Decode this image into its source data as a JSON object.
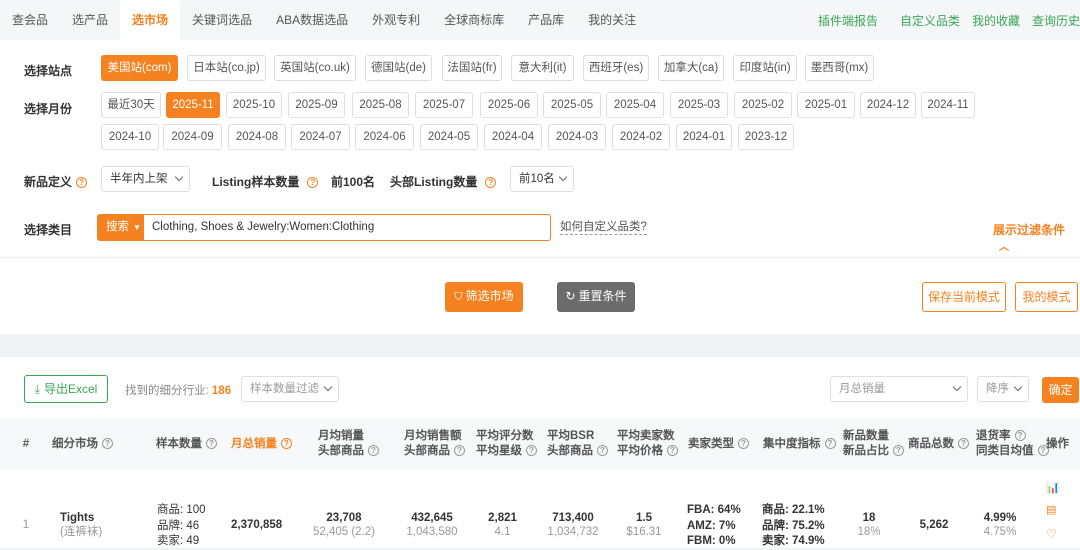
{
  "topnav": {
    "tabs": [
      "查会品",
      "选产品",
      "选市场",
      "关键词选品",
      "ABA数据选品",
      "外观专利",
      "全球商标库",
      "产品库",
      "我的关注"
    ],
    "right_links": [
      "插件端报告",
      "自定义品类",
      "我的收藏",
      "查询历史"
    ]
  },
  "filters": {
    "site_label": "选择站点",
    "sites": [
      "美国站(com)",
      "日本站(co.jp)",
      "英国站(co.uk)",
      "德国站(de)",
      "法国站(fr)",
      "意大利(it)",
      "西班牙(es)",
      "加拿大(ca)",
      "印度站(in)",
      "墨西哥(mx)"
    ],
    "month_label": "选择月份",
    "months_row1": [
      "最近30天",
      "2025-11",
      "2025-10",
      "2025-09",
      "2025-08",
      "2025-07",
      "2025-06",
      "2025-05",
      "2025-04",
      "2025-03",
      "2025-02",
      "2025-01",
      "2024-12",
      "2024-11"
    ],
    "months_row2": [
      "2024-10",
      "2024-09",
      "2024-08",
      "2024-07",
      "2024-06",
      "2024-05",
      "2024-04",
      "2024-03",
      "2024-02",
      "2024-01",
      "2023-12"
    ],
    "new_def_label": "新品定义",
    "new_def_value": "半年内上架",
    "listing_sample_label": "Listing样本数量",
    "listing_sample_value": "前100名",
    "head_listing_label": "头部Listing数量",
    "head_listing_value": "前10名",
    "category_label": "选择类目",
    "search_mode": "搜索",
    "category_value": "Clothing, Shoes & Jewelry:Women:Clothing",
    "custom_category_link": "如何自定义品类?",
    "show_filters": "展示过滤条件",
    "filter_button": "筛选市场",
    "reset_button": "重置条件",
    "save_mode_button": "保存当前模式",
    "my_mode_button": "我的模式"
  },
  "results": {
    "export_button": "导出Excel",
    "found_label": "找到的细分行业:",
    "found_count": "186",
    "sample_filter_placeholder": "样本数量过滤",
    "sort_field": "月总销量",
    "sort_order": "降序",
    "confirm_button": "确定",
    "headers": {
      "index": "#",
      "market": "细分市场",
      "sample": "样本数量",
      "monthly_total": "月总销量",
      "avg_sales_1": "月均销量",
      "avg_sales_2": "头部商品",
      "avg_revenue_1": "月均销售额",
      "avg_revenue_2": "头部商品",
      "avg_reviews_1": "平均评分数",
      "avg_reviews_2": "平均星级",
      "avg_bsr_1": "平均BSR",
      "avg_bsr_2": "头部商品",
      "avg_sellers_1": "平均卖家数",
      "avg_sellers_2": "平均价格",
      "seller_type": "卖家类型",
      "concentration": "集中度指标",
      "new_count_1": "新品数量",
      "new_count_2": "新品占比",
      "total_products": "商品总数",
      "return_rate_1": "退货率",
      "return_rate_2": "同类目均值",
      "actions": "操作"
    },
    "rows": [
      {
        "index": "1",
        "market_en": "Tights",
        "market_cn": "(连裤袜)",
        "sample_products": "商品: 100",
        "sample_brands": "品牌: 46",
        "sample_sellers": "卖家: 49",
        "monthly_total": "2,370,858",
        "avg_sales": "23,708",
        "avg_sales_head": "52,405 (2.2)",
        "avg_revenue": "432,645",
        "avg_revenue_head": "1,043,580",
        "avg_reviews": "2,821",
        "avg_rating": "4.1",
        "avg_bsr": "713,400",
        "avg_bsr_head": "1,034,732",
        "avg_sellers": "1.5",
        "avg_price": "$16.31",
        "fba": "FBA: 64%",
        "amz": "AMZ: 7%",
        "fbm": "FBM: 0%",
        "conc_products": "商品: 22.1%",
        "conc_brands": "品牌: 75.2%",
        "conc_sellers": "卖家: 74.9%",
        "new_count": "18",
        "new_ratio": "18%",
        "total_products": "5,262",
        "return_rate": "4.99%",
        "return_avg": "4.75%"
      }
    ]
  }
}
